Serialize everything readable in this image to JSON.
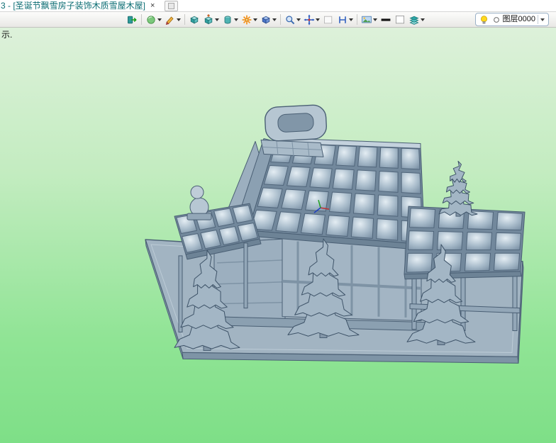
{
  "tab_bar": {
    "active_tab_title": "3 - [圣诞节飘雪房子装饰木质雪屋木屋]",
    "close_glyph": "×"
  },
  "toolbar": {
    "buttons": [
      {
        "icon": "exit-icon",
        "has_dropdown": false
      },
      {
        "icon": "render-style-icon",
        "has_dropdown": true
      },
      {
        "icon": "sketch-pencil-icon",
        "has_dropdown": true
      },
      {
        "icon": "solid-cube-icon",
        "has_dropdown": false
      },
      {
        "icon": "extrude-cube-icon",
        "has_dropdown": true
      },
      {
        "icon": "primitive-cylinder-icon",
        "has_dropdown": true
      },
      {
        "icon": "pattern-star-icon",
        "has_dropdown": true
      },
      {
        "icon": "view-cube-icon",
        "has_dropdown": true
      },
      {
        "icon": "zoom-magnifier-icon",
        "has_dropdown": true
      },
      {
        "icon": "move-crosshair-icon",
        "has_dropdown": true
      },
      {
        "icon": "blank-square-icon",
        "has_dropdown": false
      },
      {
        "icon": "measure-icon",
        "has_dropdown": true
      },
      {
        "icon": "image-icon",
        "has_dropdown": true
      },
      {
        "icon": "line-width-icon",
        "has_dropdown": false
      },
      {
        "icon": "color-swatch-icon",
        "has_dropdown": false
      },
      {
        "icon": "layers-icon",
        "has_dropdown": true
      },
      {
        "icon": "light-bulb-icon",
        "has_dropdown": false
      }
    ],
    "layer_combo": {
      "value": "图层0000"
    }
  },
  "viewport": {
    "prompt_text": "示."
  },
  "colors": {
    "background_top": "#ddf1da",
    "background_bottom": "#7edf87",
    "model_fill": "#a6b8c7",
    "model_outline": "#4a5f74",
    "tab_text": "#0d6e74"
  }
}
